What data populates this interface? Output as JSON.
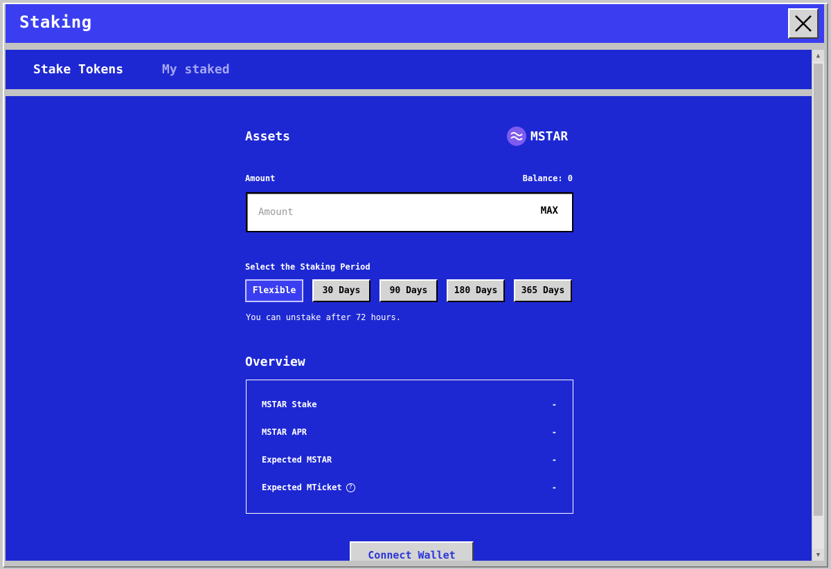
{
  "window": {
    "title": "Staking"
  },
  "tabs": [
    {
      "label": "Stake Tokens",
      "active": true
    },
    {
      "label": "My staked",
      "active": false
    }
  ],
  "assets": {
    "heading": "Assets",
    "token": "MSTAR"
  },
  "amount": {
    "label": "Amount",
    "balance_label": "Balance: 0",
    "placeholder": "Amount",
    "value": "",
    "max_label": "MAX"
  },
  "period": {
    "label": "Select the Staking Period",
    "options": [
      "Flexible",
      "30 Days",
      "90 Days",
      "180 Days",
      "365 Days"
    ],
    "selected": "Flexible",
    "note": "You can unstake after 72 hours."
  },
  "overview": {
    "heading": "Overview",
    "rows": [
      {
        "label": "MSTAR Stake",
        "value": "-"
      },
      {
        "label": "MSTAR APR",
        "value": "-"
      },
      {
        "label": "Expected MSTAR",
        "value": "-"
      },
      {
        "label": "Expected MTicket",
        "value": "-",
        "help_icon": "question-circle-icon"
      }
    ]
  },
  "connect_wallet_label": "Connect Wallet",
  "colors": {
    "titlebar": "#3a3ef0",
    "content_bg": "#1e28d2",
    "tab_inactive": "#a4a8f2",
    "token_logo": "#7e5bef",
    "button_face": "#d4d4d4"
  },
  "icons": {
    "close": "close-x-icon",
    "token_logo": "mstar-logo-icon",
    "help": "question-circle-icon",
    "scroll_up": "arrow-up-icon",
    "scroll_down": "arrow-down-icon"
  }
}
